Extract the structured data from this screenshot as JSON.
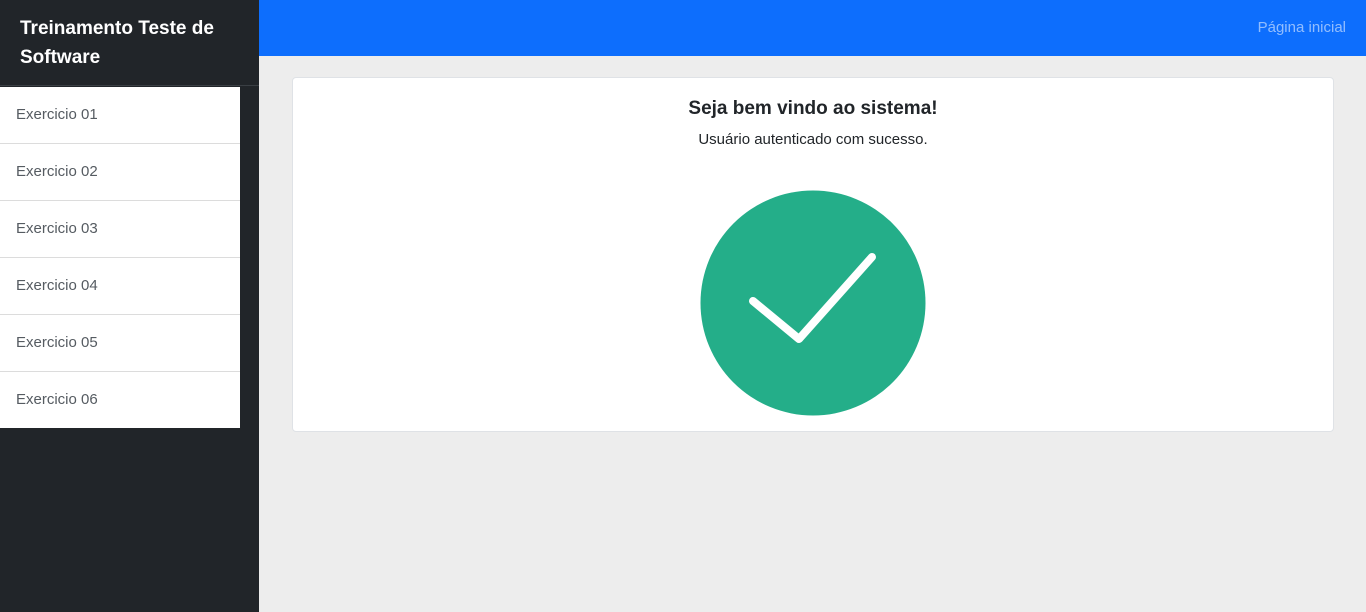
{
  "sidebar": {
    "brand": "Treinamento Teste de Software",
    "items": [
      {
        "label": "Exercicio 01"
      },
      {
        "label": "Exercicio 02"
      },
      {
        "label": "Exercicio 03"
      },
      {
        "label": "Exercicio 04"
      },
      {
        "label": "Exercicio 05"
      },
      {
        "label": "Exercicio 06"
      }
    ]
  },
  "topbar": {
    "home_link": "Página inicial"
  },
  "main": {
    "title": "Seja bem vindo ao sistema!",
    "subtitle": "Usuário autenticado com sucesso.",
    "success_icon": "check-circle-icon"
  },
  "colors": {
    "sidebar_bg": "#212529",
    "topbar_bg": "#0d6efd",
    "success_green": "#24ae89",
    "page_bg": "#ededed"
  }
}
